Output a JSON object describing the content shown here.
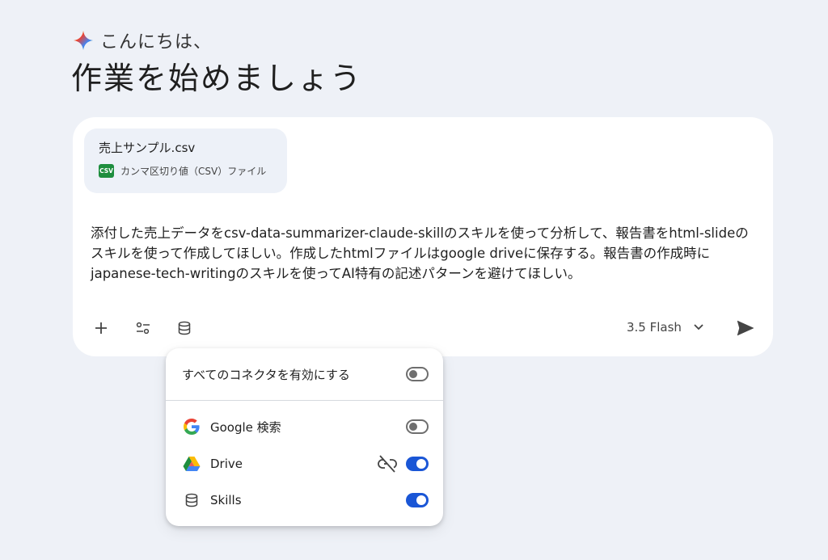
{
  "greeting": {
    "small": "こんにちは、",
    "title": "作業を始めましょう"
  },
  "attachment": {
    "file_name": "売上サンプル.csv",
    "badge": "CSV",
    "file_type": "カンマ区切り値（CSV）ファイル"
  },
  "prompt": {
    "text": "添付した売上データをcsv-data-summarizer-claude-skillのスキルを使って分析して、報告書をhtml-slideのスキルを使って作成してほしい。作成したhtmlファイルはgoogle driveに保存する。報告書の作成時にjapanese-tech-writingのスキルを使ってAI特有の記述パターンを避けてほしい。"
  },
  "toolbar": {
    "add_icon": "plus-icon",
    "tools_icon": "sliders-icon",
    "connectors_icon": "database-icon",
    "model_label": "3.5 Flash",
    "send_icon": "send-icon"
  },
  "connectors": {
    "enable_all_label": "すべてのコネクタを有効にする",
    "enable_all_on": false,
    "items": [
      {
        "label": "Google 検索",
        "icon": "google-icon",
        "enabled": false
      },
      {
        "label": "Drive",
        "icon": "google-drive-icon",
        "enabled": true,
        "extra_icon": "link-off-icon"
      },
      {
        "label": "Skills",
        "icon": "database-icon",
        "enabled": true
      }
    ]
  },
  "colors": {
    "background": "#eef1f7",
    "toggle_on": "#1a56d6",
    "csv_badge": "#1e8e3e"
  }
}
